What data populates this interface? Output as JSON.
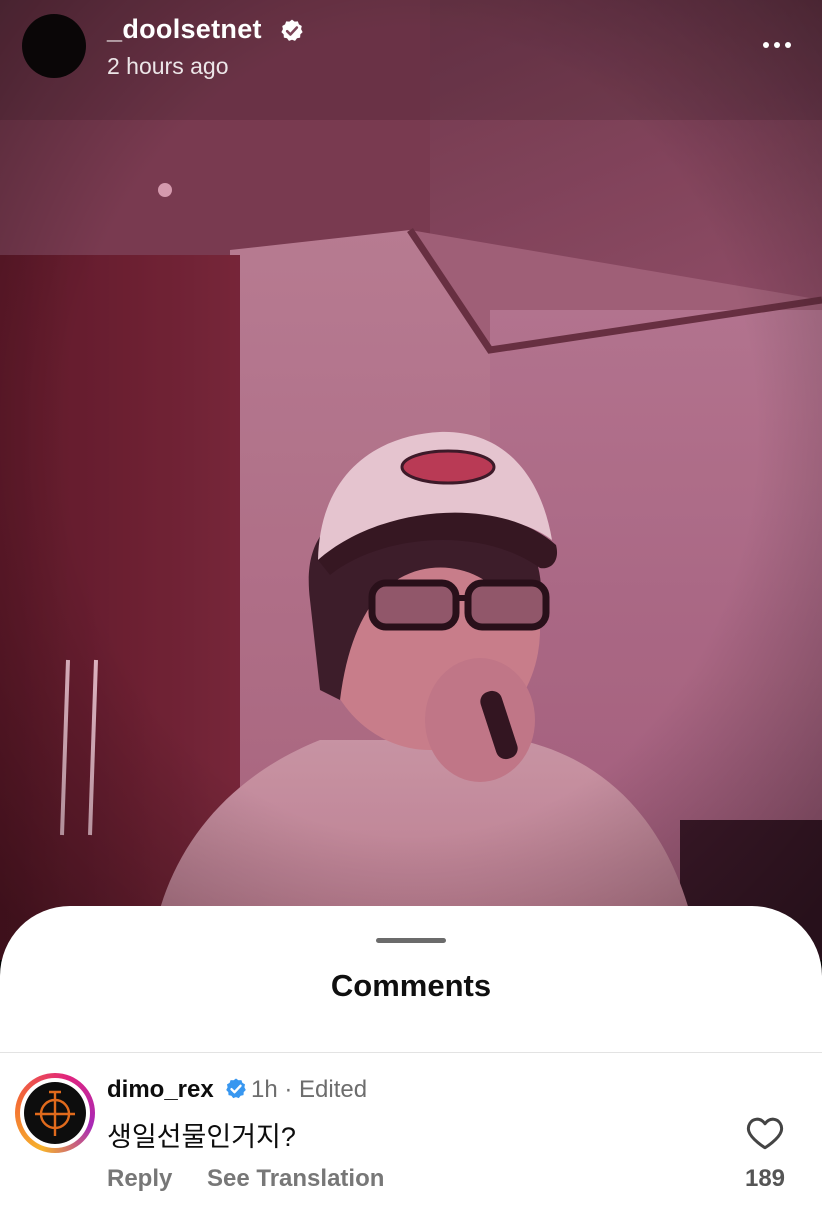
{
  "post": {
    "username": "_doolsetnet",
    "time": "2 hours ago",
    "verified_icon": "verified-badge-icon",
    "more_icon": "more-options-icon"
  },
  "sheet": {
    "title": "Comments"
  },
  "comments": [
    {
      "username": "dimo_rex",
      "verified_icon": "verified-badge-icon",
      "meta": "1h · Edited",
      "text": "생일선물인거지?",
      "reply_label": "Reply",
      "translate_label": "See Translation",
      "like_icon": "heart-icon",
      "like_count": "189"
    }
  ],
  "colors": {
    "photo_tint": "#8e4a63",
    "verified_white": "#ffffff",
    "verified_blue": "#3897f0",
    "sheet_bg": "#ffffff",
    "secondary_text": "#777777"
  }
}
